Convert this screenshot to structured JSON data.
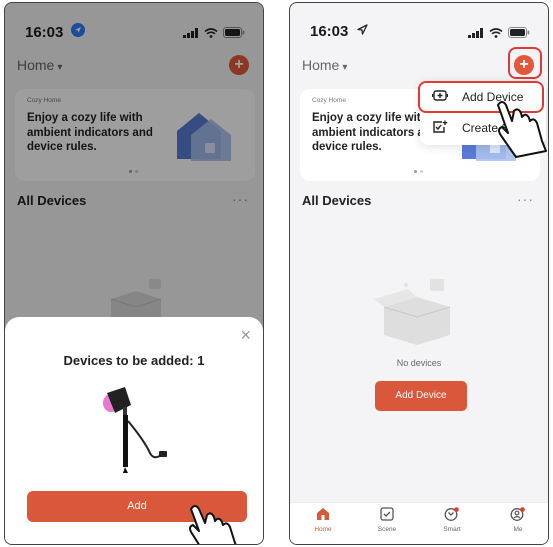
{
  "status_bar": {
    "time": "16:03"
  },
  "home": {
    "title": "Home",
    "banner_small_title": "Cozy Home",
    "banner_text": "Enjoy a cozy life with ambient indicators and device rules.",
    "all_devices_label": "All Devices",
    "more_label": "···"
  },
  "left_sheet": {
    "close_glyph": "×",
    "title": "Devices to be added: 1",
    "add_button": "Add"
  },
  "popup_menu": {
    "items": [
      {
        "label": "Add Device",
        "icon": "add-device-icon"
      },
      {
        "label": "Create Scene",
        "icon": "create-scene-icon"
      }
    ]
  },
  "empty_state": {
    "text": "No devices",
    "button": "Add Device"
  },
  "tabs": [
    {
      "label": "Home",
      "icon": "home-icon",
      "active": true
    },
    {
      "label": "Scene",
      "icon": "scene-icon",
      "active": false
    },
    {
      "label": "Smart",
      "icon": "smart-icon",
      "active": false
    },
    {
      "label": "Me",
      "icon": "me-icon",
      "active": false
    }
  ],
  "colors": {
    "accent": "#d9583b",
    "highlight": "#e03a34",
    "background": "#f4f4f6"
  }
}
